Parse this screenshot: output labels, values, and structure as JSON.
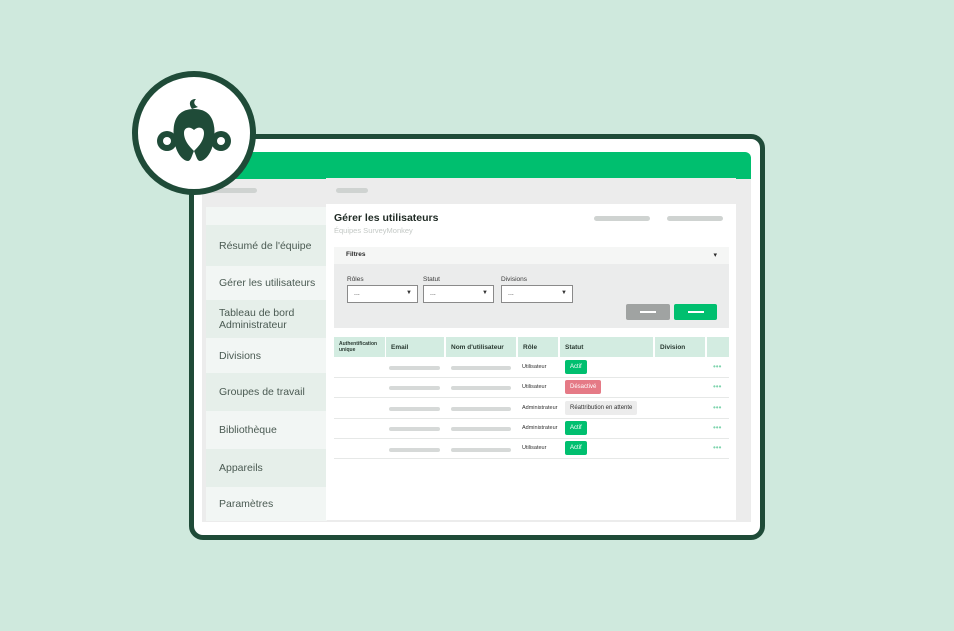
{
  "colors": {
    "background": "#cfe9dd",
    "brand_green": "#00bf6f",
    "dark_green": "#1f4b38",
    "deactivated": "#e57a86"
  },
  "sidebar": {
    "items": [
      {
        "label": "Résumé de l'équipe"
      },
      {
        "label": "Gérer les utilisateurs"
      },
      {
        "label": "Tableau de bord Administrateur"
      },
      {
        "label": "Divisions"
      },
      {
        "label": "Groupes de travail"
      },
      {
        "label": "Bibliothèque"
      },
      {
        "label": "Appareils"
      },
      {
        "label": "Paramètres"
      }
    ]
  },
  "main": {
    "title": "Gérer les utilisateurs",
    "subtitle": "Équipes SurveyMonkey"
  },
  "filters": {
    "heading": "Filtres",
    "toggle_icon": "▾",
    "roles": {
      "label": "Rôles",
      "value": "..."
    },
    "status": {
      "label": "Statut",
      "value": "..."
    },
    "divisions": {
      "label": "Divisions",
      "value": "..."
    }
  },
  "table": {
    "columns": [
      "Authentification unique",
      "Email",
      "Nom d'utilisateur",
      "Rôle",
      "Statut",
      "Division"
    ],
    "rows": [
      {
        "role": "Utilisateur",
        "status": "Actif",
        "status_type": "active"
      },
      {
        "role": "Utilisateur",
        "status": "Désactivé",
        "status_type": "deactivated"
      },
      {
        "role": "Administrateur",
        "status": "Réattribution en attente",
        "status_type": "pending"
      },
      {
        "role": "Administrateur",
        "status": "Actif",
        "status_type": "active"
      },
      {
        "role": "Utilisateur",
        "status": "Actif",
        "status_type": "active"
      }
    ],
    "row_menu": "•••"
  },
  "icons": {
    "logo": "surveymonkey-logo-icon",
    "dropdown": "chevron-down-icon",
    "row_menu": "more-dots-icon"
  }
}
